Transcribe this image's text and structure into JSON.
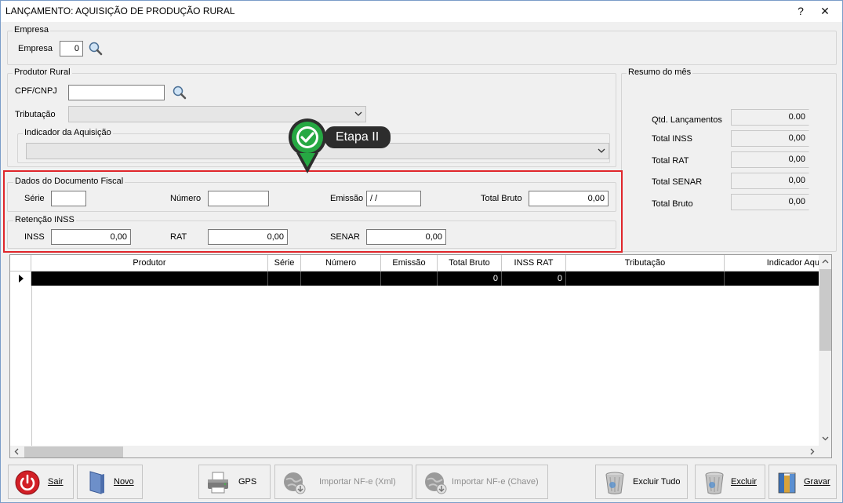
{
  "window": {
    "title": "LANÇAMENTO: AQUISIÇÃO DE PRODUÇÃO RURAL",
    "help": "?",
    "close": "✕"
  },
  "empresa": {
    "legend": "Empresa",
    "label": "Empresa",
    "value": "0"
  },
  "produtor": {
    "legend": "Produtor Rural",
    "cpf_label": "CPF/CNPJ",
    "cpf_value": "",
    "tributacao_label": "Tributação",
    "indicador_legend": "Indicador da Aquisição"
  },
  "resumo": {
    "legend": "Resumo do mês",
    "rows": [
      {
        "label": "Qtd. Lançamentos",
        "value": "0.00"
      },
      {
        "label": "Total INSS",
        "value": "0,00"
      },
      {
        "label": "Total RAT",
        "value": "0,00"
      },
      {
        "label": "Total SENAR",
        "value": "0,00"
      },
      {
        "label": "Total Bruto",
        "value": "0,00"
      }
    ]
  },
  "documento": {
    "legend": "Dados do Documento Fiscal",
    "serie_label": "Série",
    "serie_value": "",
    "numero_label": "Número",
    "numero_value": "",
    "emissao_label": "Emissão",
    "emissao_value": " /  /",
    "total_label": "Total Bruto",
    "total_value": "0,00"
  },
  "retencao": {
    "legend": "Retenção INSS",
    "inss_label": "INSS",
    "inss_value": "0,00",
    "rat_label": "RAT",
    "rat_value": "0,00",
    "senar_label": "SENAR",
    "senar_value": "0,00"
  },
  "callout": {
    "text": "Etapa II"
  },
  "grid": {
    "columns": [
      "Produtor",
      "Série",
      "Número",
      "Emissão",
      "Total Bruto",
      "INSS RAT",
      "Tributação",
      "Indicador Aqu"
    ],
    "row": [
      "",
      "",
      "",
      "",
      "0",
      "0",
      "",
      ""
    ]
  },
  "buttons": {
    "sair": "Sair",
    "novo": "Novo",
    "gps": "GPS",
    "importar_xml": "Importar NF-e (Xml)",
    "importar_chave": "Importar NF-e (Chave)",
    "excluir_tudo": "Excluir Tudo",
    "excluir": "Excluir",
    "gravar": "Gravar"
  }
}
